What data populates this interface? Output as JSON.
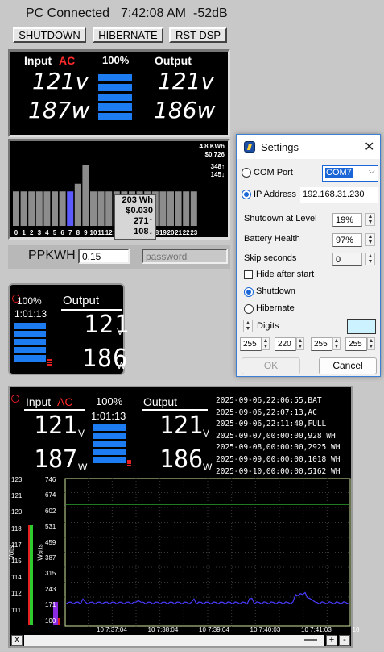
{
  "top": {
    "status": "PC Connected",
    "time": "7:42:08 AM",
    "signal": "-52dB",
    "buttons": [
      "SHUTDOWN",
      "HIBERNATE",
      "RST DSP"
    ]
  },
  "main_panel": {
    "input_label": "Input",
    "ac_label": "AC",
    "percent": "100%",
    "output_label": "Output",
    "input_volts": "121v",
    "input_watts": "187w",
    "output_volts": "121v",
    "output_watts": "186w"
  },
  "hourly": {
    "kwh": "4.8 KWh",
    "cost": "$0.726",
    "max": "348↑",
    "min": "145↓",
    "hour_labels": [
      "0",
      "1",
      "2",
      "3",
      "4",
      "5",
      "6",
      "7",
      "8",
      "9",
      "10",
      "11",
      "12",
      "13",
      "14",
      "15",
      "16",
      "17",
      "18",
      "19",
      "20",
      "21",
      "22",
      "23"
    ],
    "bar_levels": [
      0.45,
      0.45,
      0.45,
      0.45,
      0.45,
      0.45,
      0.45,
      0.45,
      0.55,
      0.8,
      0.45,
      0.45,
      0.45,
      0.45,
      0.45,
      0.45,
      0.45,
      0.45,
      0.45,
      0.45,
      0.45,
      0.45,
      0.45,
      0.45
    ],
    "current_hour_index": 7,
    "tooltip": {
      "wh": "203 Wh",
      "cost": "$0.030",
      "max": "271↑",
      "min": "108↓"
    }
  },
  "ppkwh": {
    "label": "PPKWH",
    "value": "0.15",
    "password_placeholder": "password"
  },
  "mini": {
    "percent": "100%",
    "runtime": "1:01:13",
    "output_label": "Output",
    "volts": "121",
    "volts_unit": "V",
    "watts": "186",
    "watts_unit": "W"
  },
  "settings": {
    "title": "Settings",
    "com_port_label": "COM Port",
    "com_port_value": "COM7",
    "ip_label": "IP Address",
    "ip_value": "192.168.31.230",
    "shutdown_level_label": "Shutdown at Level",
    "shutdown_level_value": "19%",
    "battery_health_label": "Battery Health",
    "battery_health_value": "97%",
    "skip_seconds_label": "Skip seconds",
    "skip_seconds_value": "0",
    "hide_after_start_label": "Hide after start",
    "shutdown_radio_label": "Shutdown",
    "hibernate_radio_label": "Hibernate",
    "digits_label": "Digits",
    "color_values": [
      "255",
      "220",
      "255",
      "255"
    ],
    "color_swatch": "#ccf2ff",
    "ok_label": "OK",
    "cancel_label": "Cancel"
  },
  "big": {
    "input_label": "Input",
    "ac_label": "AC",
    "percent": "100%",
    "runtime": "1:01:13",
    "output_label": "Output",
    "in_volts": "121",
    "in_watts": "187",
    "out_volts": "121",
    "out_watts": "186",
    "volts_unit": "V",
    "watts_unit": "W",
    "log": [
      "2025-09-06,22:06:55,BAT",
      "2025-09-06,22:07:13,AC",
      "2025-09-06,22:11:40,FULL",
      "2025-09-07,00:00:00,928 WH",
      "2025-09-08,00:00:00,2925 WH",
      "2025-09-09,00:00:00,1018 WH",
      "2025-09-10,00:00:00,5162 WH"
    ]
  },
  "graph": {
    "volts_ticks": [
      "123",
      "121",
      "120",
      "118",
      "117",
      "115",
      "114",
      "112",
      "111"
    ],
    "watts_ticks": [
      "746",
      "674",
      "602",
      "531",
      "459",
      "387",
      "315",
      "243",
      "171",
      "100"
    ],
    "volts_label": "Volts",
    "watts_label": "Watts",
    "x_ticks": [
      "10 7:37:04",
      "10 7:38:04",
      "10 7:39:04",
      "10 7:40:03",
      "10 7:41:03",
      "10"
    ],
    "close_label": "X",
    "zoom_in": "+",
    "zoom_out": "-"
  }
}
